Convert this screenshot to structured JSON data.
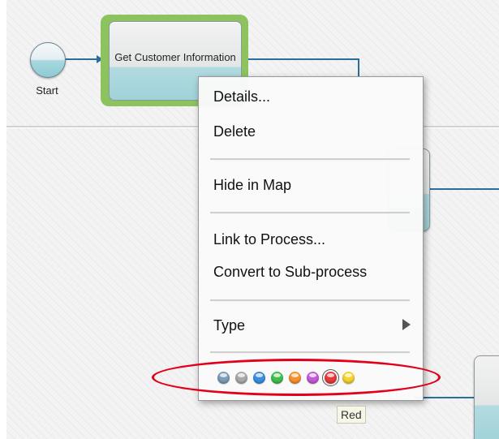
{
  "diagram": {
    "start_label": "Start",
    "selected_task_label": "Get Customer Information"
  },
  "menu": {
    "items": {
      "details": "Details...",
      "delete": "Delete",
      "hide_in_map": "Hide in Map",
      "link_to_process": "Link to Process...",
      "convert_to_subprocess": "Convert to Sub-process",
      "type": "Type"
    },
    "color_swatches": [
      {
        "name": "Slate Blue",
        "color": "#7a9db8"
      },
      {
        "name": "Gray",
        "color": "#a9a9a9"
      },
      {
        "name": "Blue",
        "color": "#3a8fe3"
      },
      {
        "name": "Green",
        "color": "#3fbf4f"
      },
      {
        "name": "Orange",
        "color": "#f5922e"
      },
      {
        "name": "Purple",
        "color": "#c45ad6"
      },
      {
        "name": "Red",
        "color": "#e83a3a"
      },
      {
        "name": "Yellow",
        "color": "#f5d22e"
      }
    ],
    "selected_color_index": 6
  },
  "tooltip": "Red",
  "colors": {
    "selection_green": "#8dc35f",
    "connector": "#2a6e9c",
    "annotation_red": "#e3001b"
  }
}
